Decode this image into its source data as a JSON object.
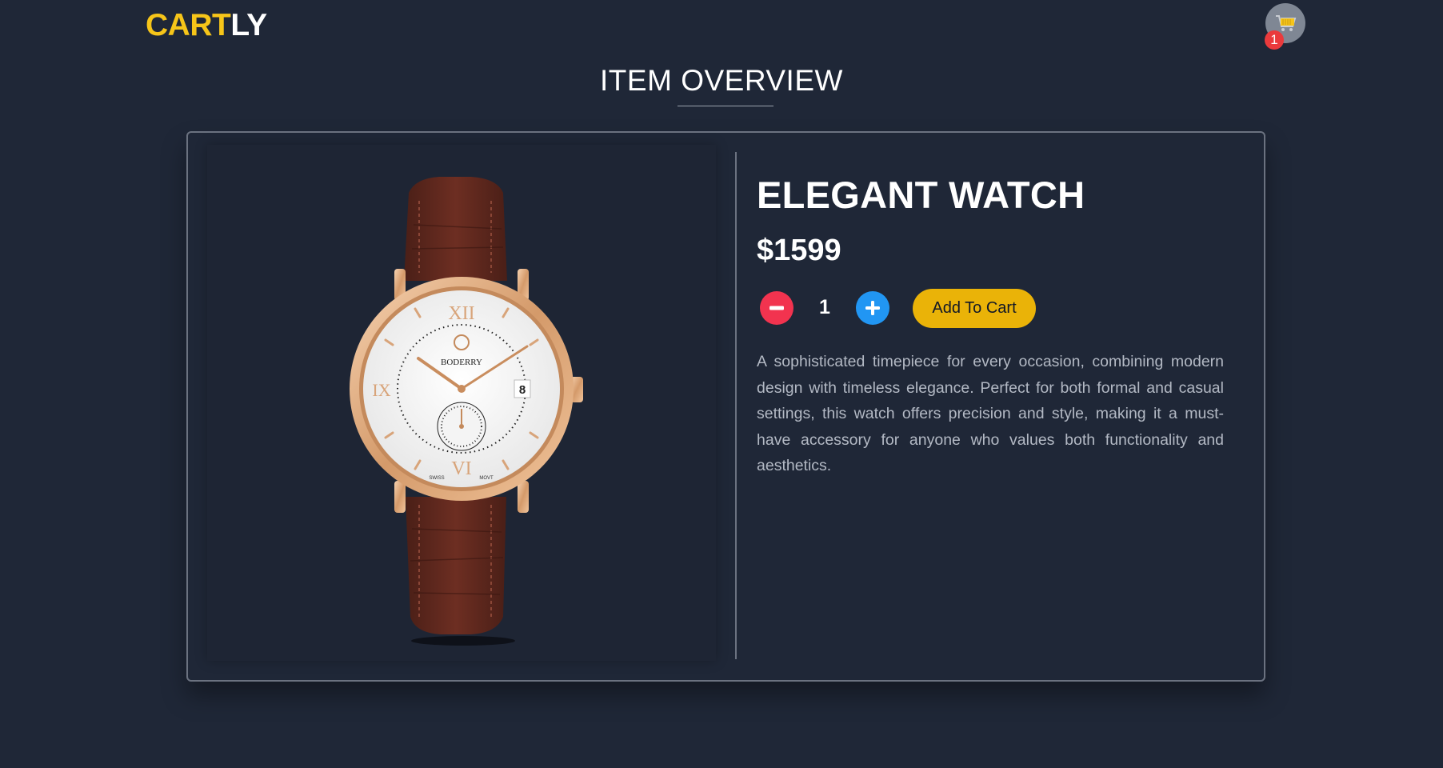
{
  "header": {
    "logo_part1": "CART",
    "logo_part2": "LY",
    "cart_icon": "shopping-cart-icon",
    "cart_count": "1"
  },
  "page": {
    "title": "ITEM OVERVIEW"
  },
  "product": {
    "image_icon": "wristwatch-image",
    "name": "ELEGANT WATCH",
    "price": "$1599",
    "quantity": "1",
    "minus_icon": "minus-icon",
    "plus_icon": "plus-icon",
    "add_to_cart_label": "Add To Cart",
    "description": "A sophisticated timepiece for every occasion, combining modern design with timeless elegance. Perfect for both formal and casual settings, this watch offers precision and style, making it a must-have accessory for anyone who values both functionality and aesthetics.",
    "watch_brand": "BODERRY",
    "watch_date": "8",
    "watch_sub_left": "SWISS",
    "watch_sub_right": "MOVT"
  },
  "colors": {
    "background": "#1f2737",
    "accent": "#f6c519",
    "button_add": "#eab308",
    "minus": "#f2334f",
    "plus": "#2196f3",
    "badge": "#ea3a3c"
  }
}
